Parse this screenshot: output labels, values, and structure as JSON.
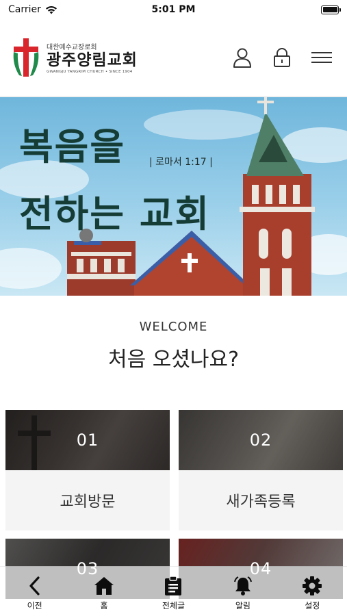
{
  "status_bar": {
    "carrier": "Carrier",
    "time": "5:01 PM"
  },
  "header": {
    "logo": {
      "denomination": "대한예수교장로회",
      "name": "광주양림교회",
      "subtitle": "GWANGJU YANGRIM CHURCH • SINCE 1904"
    },
    "icons": [
      "user-icon",
      "lock-icon",
      "menu-icon"
    ]
  },
  "hero": {
    "line1": "복음을",
    "line2": "전하는 교회",
    "verse": "| 로마서 1:17 |"
  },
  "welcome": {
    "label": "WELCOME",
    "title": "처음 오셨나요?"
  },
  "cards": [
    {
      "number": "01",
      "label": "교회방문"
    },
    {
      "number": "02",
      "label": "새가족등록"
    },
    {
      "number": "03",
      "label": ""
    },
    {
      "number": "04",
      "label": ""
    }
  ],
  "tab_bar": {
    "items": [
      {
        "label": "이전",
        "icon": "back-icon"
      },
      {
        "label": "홈",
        "icon": "home-icon"
      },
      {
        "label": "전체글",
        "icon": "clipboard-icon"
      },
      {
        "label": "알림",
        "icon": "bell-icon"
      },
      {
        "label": "설정",
        "icon": "gear-icon"
      }
    ]
  },
  "colors": {
    "logo_red": "#d8262c",
    "logo_green": "#1f8a4a",
    "hero_text": "#163c36",
    "card_label_bg": "#f4f4f4"
  }
}
